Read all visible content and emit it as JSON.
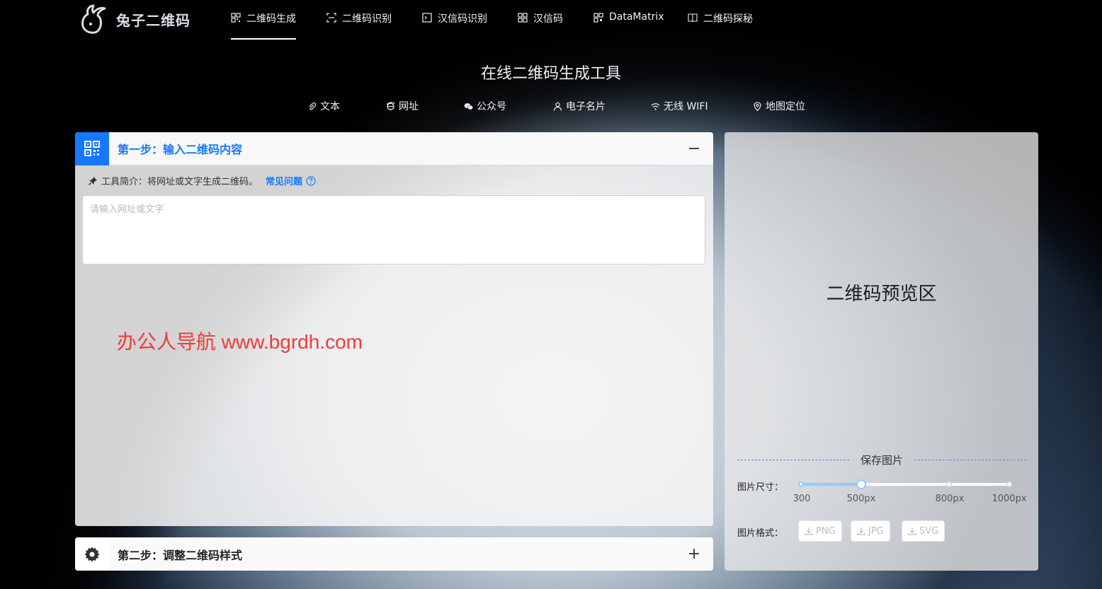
{
  "brand": {
    "name": "兔子二维码"
  },
  "nav": [
    {
      "label": "二维码生成",
      "icon": "qrcode-icon",
      "active": true
    },
    {
      "label": "二维码识别",
      "icon": "scan-icon"
    },
    {
      "label": "汉信码识别",
      "icon": "terminal-icon"
    },
    {
      "label": "汉信码",
      "icon": "hanxin-icon"
    },
    {
      "label": "DataMatrix",
      "icon": "datamatrix-icon"
    },
    {
      "label": "二维码探秘",
      "icon": "book-icon"
    }
  ],
  "page_title": "在线二维码生成工具",
  "type_tabs": [
    {
      "label": "文本",
      "icon": "paperclip-icon"
    },
    {
      "label": "网址",
      "icon": "ie-icon"
    },
    {
      "label": "公众号",
      "icon": "wechat-icon"
    },
    {
      "label": "电子名片",
      "icon": "user-icon"
    },
    {
      "label": "无线 WIFI",
      "icon": "wifi-icon"
    },
    {
      "label": "地图定位",
      "icon": "location-icon"
    }
  ],
  "step1": {
    "title": "第一步：输入二维码内容",
    "intro_prefix": "工具简介：将网址或文字生成二维码。",
    "faq": "常见问题",
    "input_placeholder": "请输入网址或文字",
    "input_value": ""
  },
  "watermark": "办公人导航 www.bgrdh.com",
  "step2": {
    "title": "第二步：调整二维码样式"
  },
  "preview": {
    "text": "二维码预览区",
    "save_title": "保存图片",
    "size_label": "图片尺寸：",
    "size_marks": [
      "300",
      "500px",
      "800px",
      "1000px"
    ],
    "size_value": "500px",
    "format_label": "图片格式：",
    "formats": [
      "PNG",
      "JPG",
      "SVG"
    ]
  },
  "colors": {
    "accent": "#1677ff",
    "watermark": "#ef3b3b",
    "slider": "#91caff"
  }
}
